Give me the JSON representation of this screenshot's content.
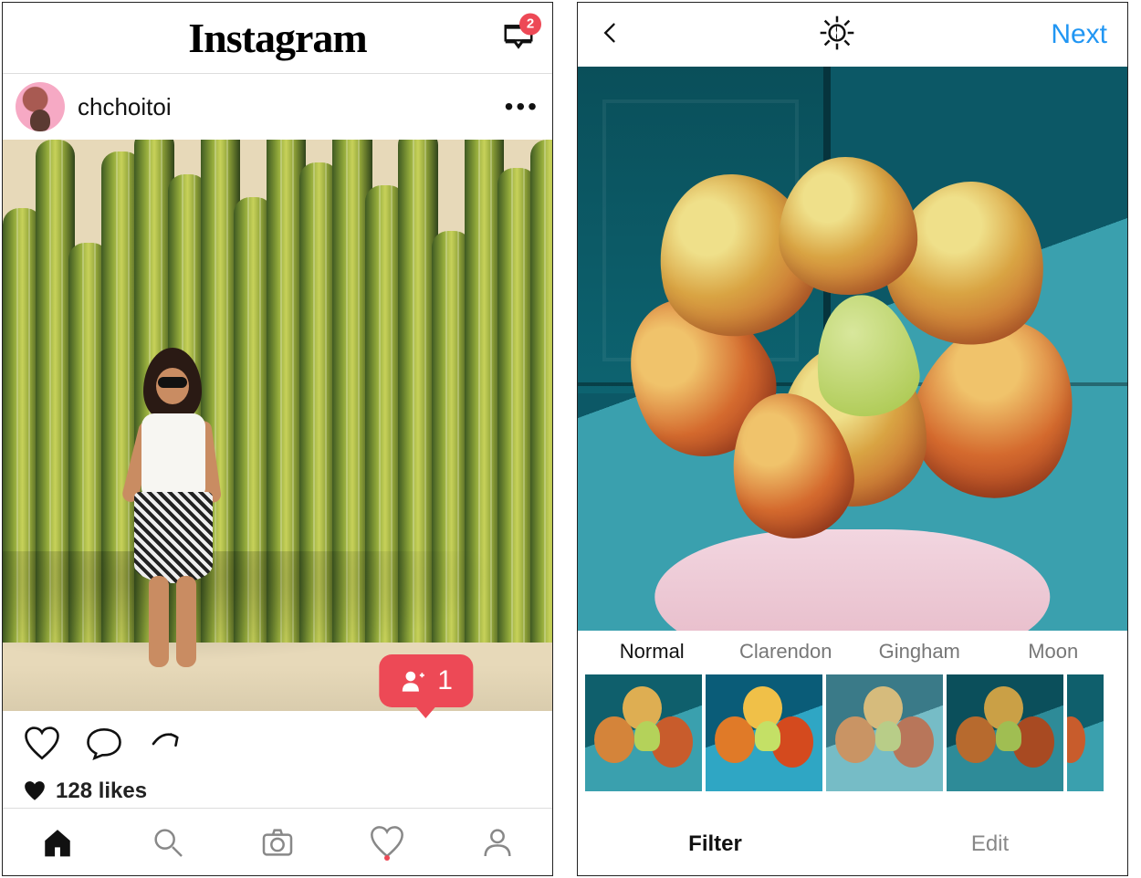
{
  "feed": {
    "logo": "Instagram",
    "inbox_badge": "2",
    "post": {
      "username": "chchoitoi",
      "likes_label": "128 likes"
    },
    "activity_bubble_count": "1",
    "nav": {
      "items": [
        "home",
        "search",
        "camera",
        "activity",
        "profile"
      ],
      "active": "home"
    }
  },
  "editor": {
    "next_label": "Next",
    "filters": [
      {
        "name": "Normal",
        "selected": true
      },
      {
        "name": "Clarendon",
        "selected": false
      },
      {
        "name": "Gingham",
        "selected": false
      },
      {
        "name": "Moon",
        "selected": false
      }
    ],
    "tabs": {
      "filter": "Filter",
      "edit": "Edit",
      "active": "filter"
    }
  },
  "colors": {
    "accent_red": "#ed4956",
    "accent_blue": "#2196f3"
  }
}
